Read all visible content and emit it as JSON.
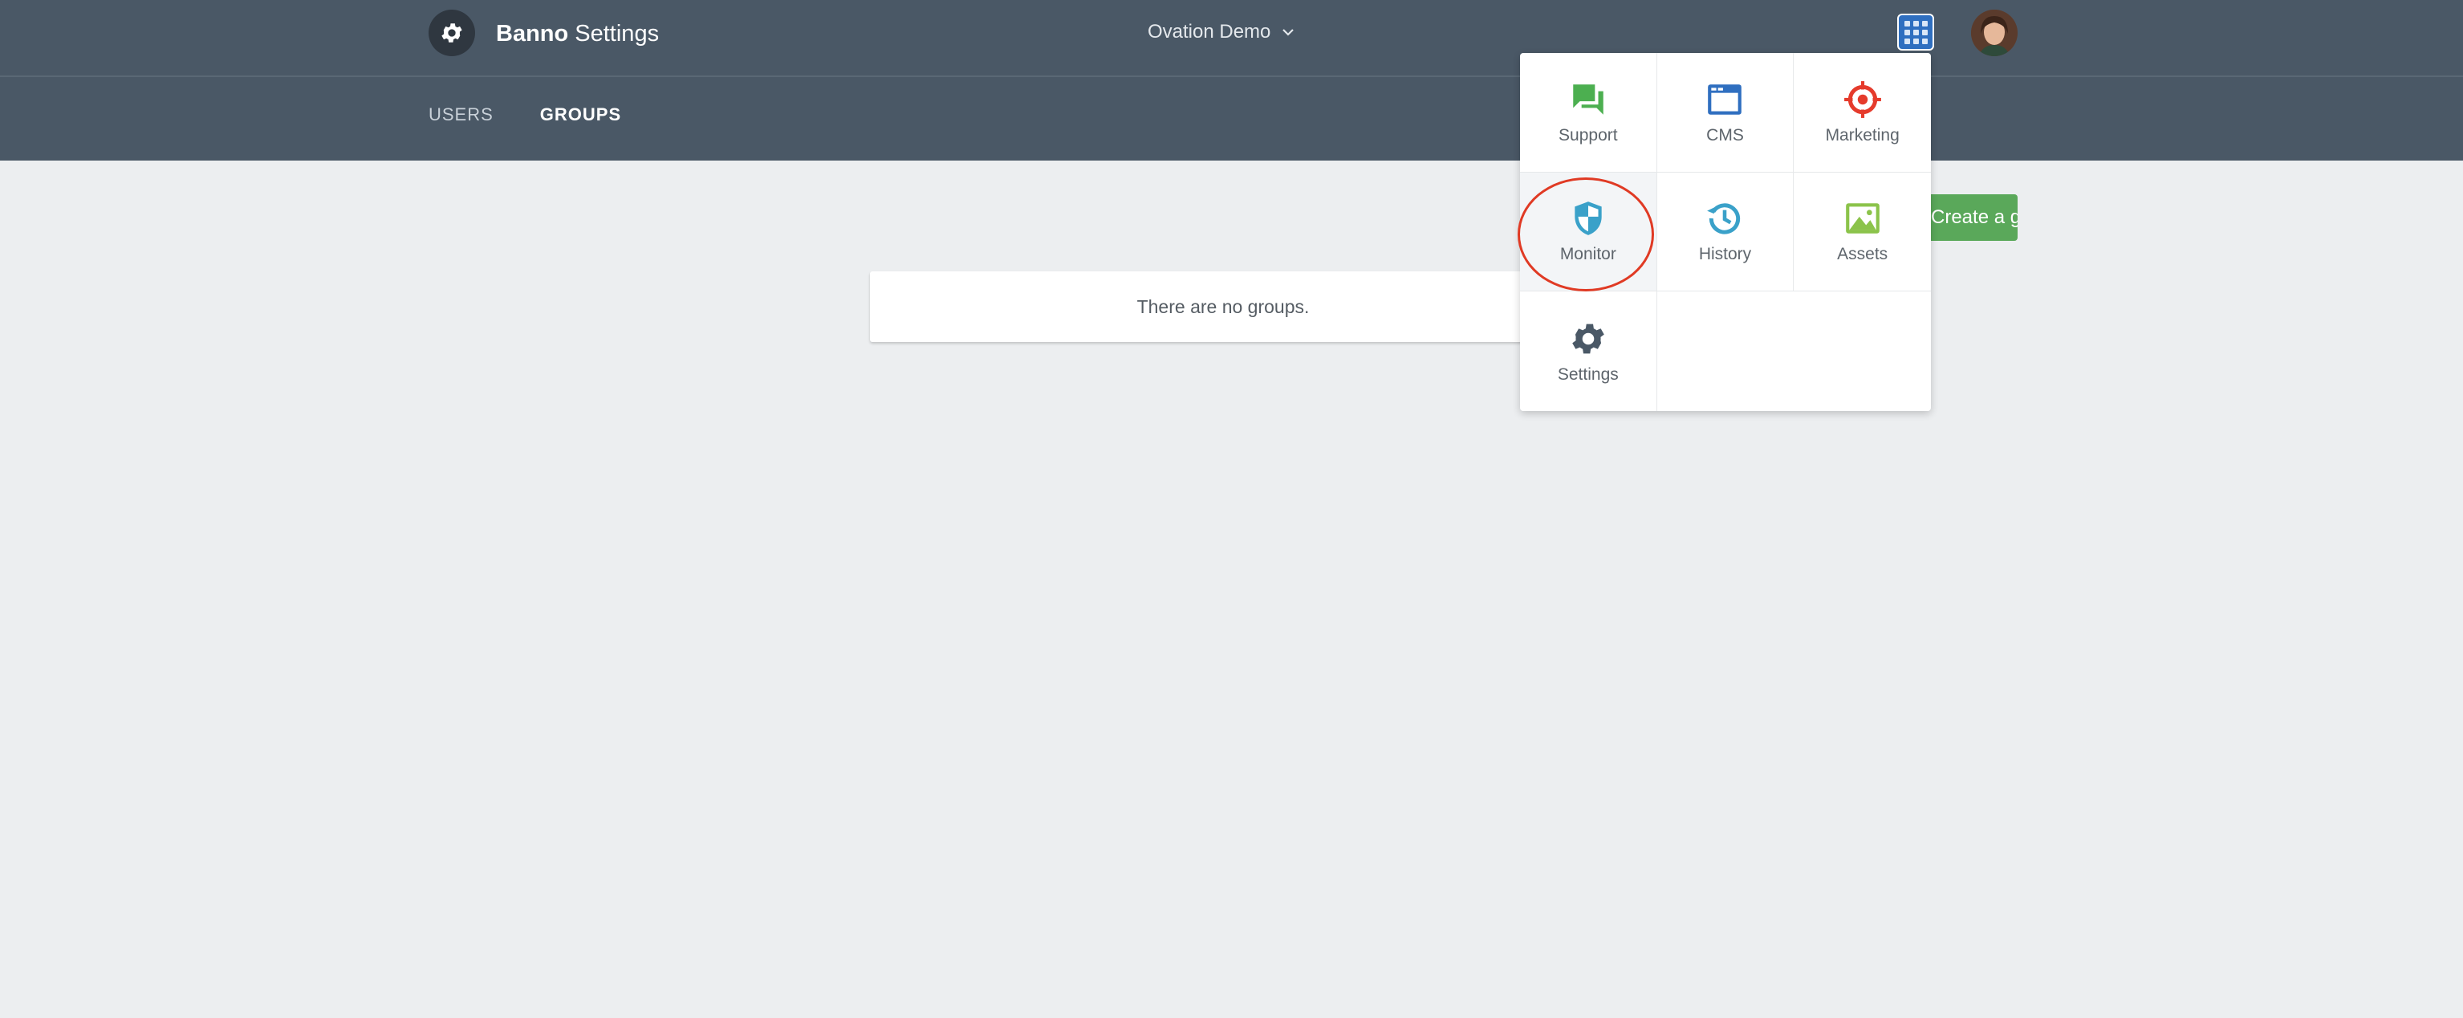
{
  "header": {
    "brand": "Banno",
    "title": "Settings",
    "org_selector": {
      "label": "Ovation Demo"
    }
  },
  "tabs": [
    {
      "label": "USERS",
      "active": false
    },
    {
      "label": "GROUPS",
      "active": true
    }
  ],
  "main": {
    "create_button_label": "Create a group",
    "empty_message": "There are no groups."
  },
  "apps_menu": {
    "items": [
      {
        "label": "Support",
        "icon": "chat-bubbles-icon",
        "color": "#4caf50"
      },
      {
        "label": "CMS",
        "icon": "browser-window-icon",
        "color": "#2f6fc0"
      },
      {
        "label": "Marketing",
        "icon": "target-icon",
        "color": "#e53b2c"
      },
      {
        "label": "Monitor",
        "icon": "shield-icon",
        "color": "#3aa1c9"
      },
      {
        "label": "History",
        "icon": "history-clock-icon",
        "color": "#3aa1c9"
      },
      {
        "label": "Assets",
        "icon": "image-icon",
        "color": "#8bc34a"
      },
      {
        "label": "Settings",
        "icon": "gear-icon",
        "color": "#4a5866"
      }
    ]
  },
  "colors": {
    "header_bg": "#4a5866",
    "page_bg": "#eceef0",
    "primary_button": "#5aa85a",
    "annotation": "#e03a24"
  }
}
